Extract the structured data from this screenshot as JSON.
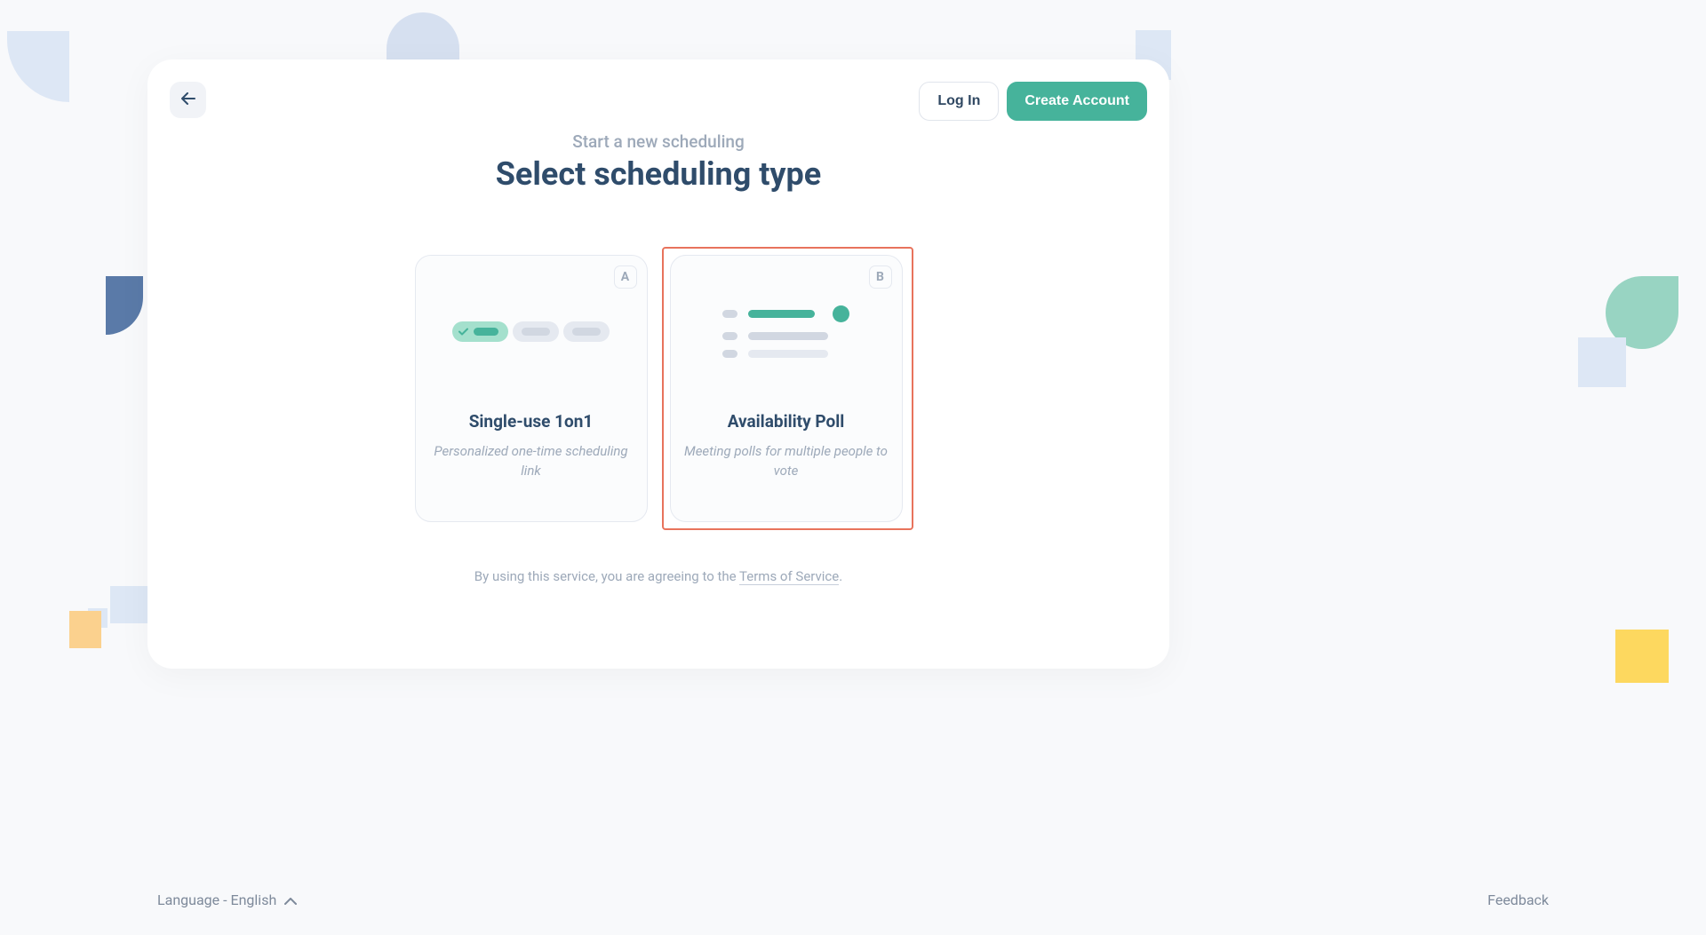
{
  "header": {
    "login_label": "Log In",
    "create_label": "Create Account"
  },
  "page": {
    "subtitle": "Start a new scheduling",
    "title": "Select scheduling type"
  },
  "cards": [
    {
      "key": "A",
      "title": "Single-use 1on1",
      "description": "Personalized one-time scheduling link"
    },
    {
      "key": "B",
      "title": "Availability Poll",
      "description": "Meeting polls for multiple people to vote"
    }
  ],
  "terms": {
    "prefix": "By using this service, you are agreeing to the ",
    "link_label": "Terms of Service",
    "suffix": "."
  },
  "footer": {
    "language_label": "Language - English",
    "feedback_label": "Feedback"
  }
}
